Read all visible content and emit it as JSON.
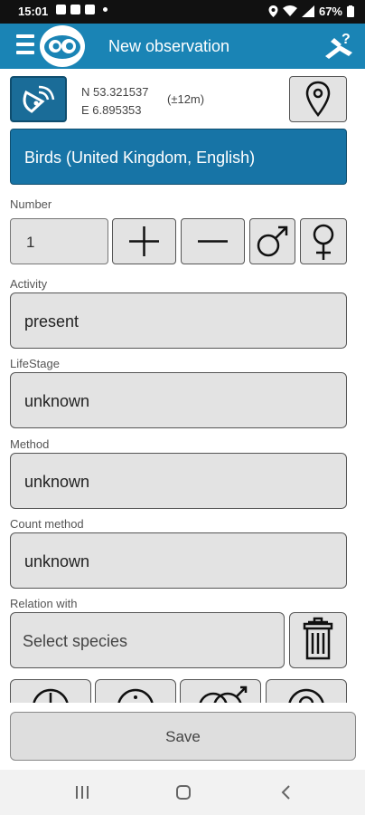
{
  "status_bar": {
    "time": "15:01",
    "battery": "67%"
  },
  "app_bar": {
    "title": "New observation",
    "icons": [
      "menu-icon",
      "app-logo",
      "help-identify-icon"
    ]
  },
  "location": {
    "latitude": "N 53.321537",
    "longitude": "E 6.895353",
    "accuracy": "(±12m)",
    "icons": [
      "satellite-dish-icon",
      "map-pin-icon"
    ]
  },
  "species_group": {
    "label": "Birds (United Kingdom, English)"
  },
  "number": {
    "label": "Number",
    "value": "1",
    "buttons": [
      "plus-icon",
      "minus-icon",
      "male-icon",
      "female-icon"
    ]
  },
  "activity": {
    "label": "Activity",
    "value": "present"
  },
  "life_stage": {
    "label": "LifeStage",
    "value": "unknown"
  },
  "method": {
    "label": "Method",
    "value": "unknown"
  },
  "count_method": {
    "label": "Count method",
    "value": "unknown"
  },
  "relation": {
    "label": "Relation with",
    "placeholder": "Select species",
    "icon": "trash-icon"
  },
  "actions": {
    "save_label": "Save"
  },
  "colors": {
    "app_bar": "#1a84b5",
    "species_bg": "#1774a6",
    "field_bg": "#e3e3e3"
  }
}
